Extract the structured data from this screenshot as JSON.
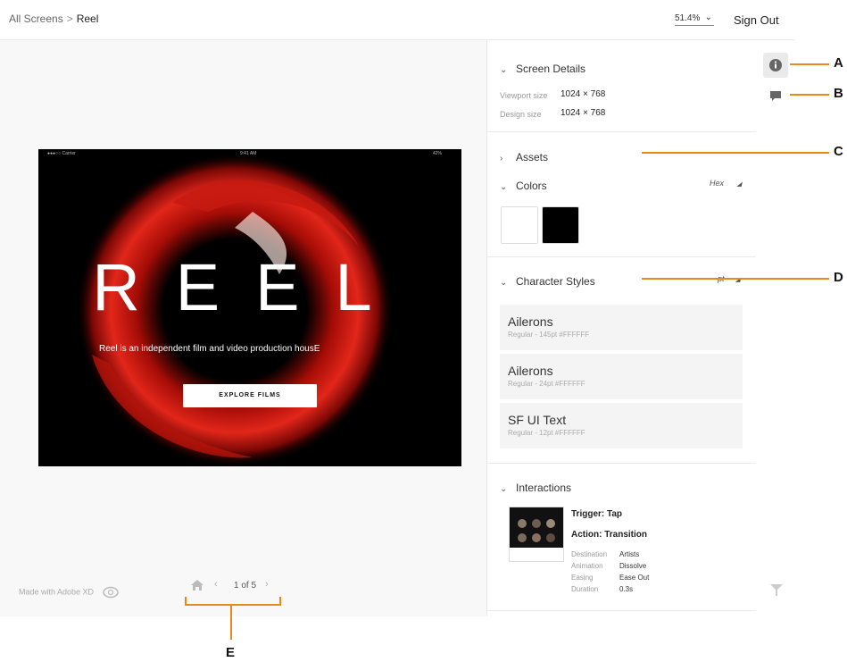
{
  "breadcrumb": {
    "root": "All Screens",
    "separator": ">",
    "current": "Reel"
  },
  "zoom": {
    "value": "51.4%",
    "icon": "chevron-down-icon"
  },
  "header": {
    "sign_out": "Sign Out"
  },
  "artboard": {
    "status_left": "●●●○○ Carrier",
    "status_time": "9:41 AM",
    "status_right": "42%",
    "title": "REEL",
    "subtitle": "Reel is an independent film and video production housE",
    "cta": "EXPLORE FILMS"
  },
  "footer": {
    "made_with": "Made with Adobe XD",
    "page_indicator": "1 of 5"
  },
  "panel": {
    "screen_details": {
      "title": "Screen Details",
      "viewport_label": "Viewport size",
      "viewport_value": "1024 × 768",
      "design_label": "Design size",
      "design_value": "1024 × 768"
    },
    "assets": {
      "title": "Assets"
    },
    "colors": {
      "title": "Colors",
      "format": "Hex",
      "swatches": [
        "#FFFFFF",
        "#000000"
      ]
    },
    "character_styles": {
      "title": "Character Styles",
      "unit": "pt",
      "items": [
        {
          "name": "Ailerons",
          "meta": "Regular - 145pt #FFFFFF"
        },
        {
          "name": "Ailerons",
          "meta": "Regular - 24pt #FFFFFF"
        },
        {
          "name": "SF UI Text",
          "meta": "Regular - 12pt #FFFFFF"
        }
      ]
    },
    "interactions": {
      "title": "Interactions",
      "trigger": "Trigger: Tap",
      "action": "Action: Transition",
      "details": [
        {
          "label": "Destination",
          "value": "Artists"
        },
        {
          "label": "Animation",
          "value": "Dissolve"
        },
        {
          "label": "Easing",
          "value": "Ease Out"
        },
        {
          "label": "Duration",
          "value": "0.3s"
        }
      ]
    }
  },
  "callouts": {
    "a": "A",
    "b": "B",
    "c": "C",
    "d": "D",
    "e": "E"
  },
  "colors": {
    "accent": "#e8891c",
    "red": "#d7190f"
  }
}
